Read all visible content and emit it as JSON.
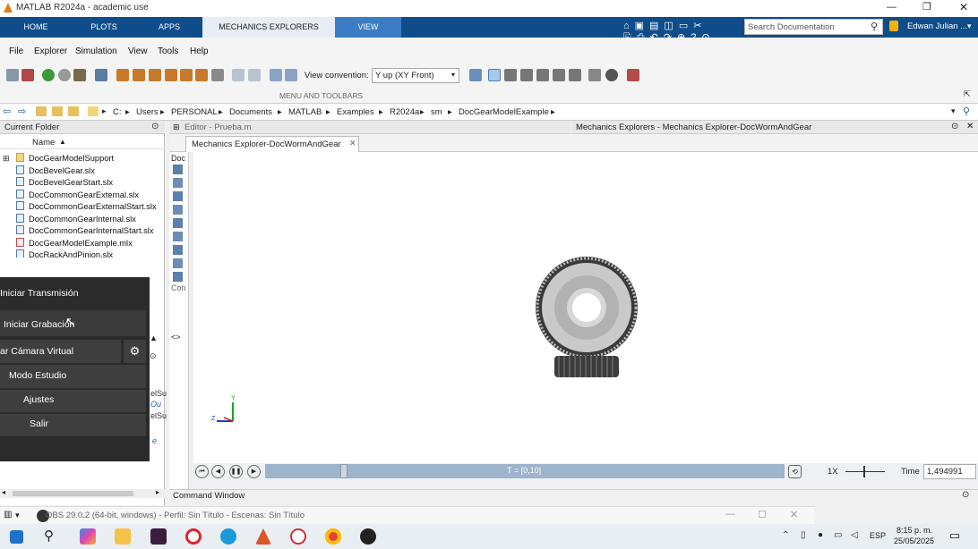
{
  "window": {
    "title": "MATLAB R2024a - academic use"
  },
  "ribbon": {
    "tabs": [
      "HOME",
      "PLOTS",
      "APPS",
      "MECHANICS EXPLORERS",
      "VIEW"
    ],
    "search_placeholder": "Search Documentation",
    "user": "Edwan Julian ...",
    "section_label": "MENU AND TOOLBARS"
  },
  "menu": {
    "items": [
      "File",
      "Explorer",
      "Simulation",
      "View",
      "Tools",
      "Help"
    ],
    "view_convention_label": "View convention:",
    "view_convention_value": "Y up (XY Front)"
  },
  "path": {
    "crumbs": [
      "C:",
      "Users",
      "PERSONAL",
      "Documents",
      "MATLAB",
      "Examples",
      "R2024a",
      "sm",
      "DocGearModelExample"
    ]
  },
  "current_folder": {
    "title": "Current Folder",
    "column": "Name",
    "items": [
      "DocGearModelSupport",
      "DocBevelGear.slx",
      "DocBevelGearStart.slx",
      "DocCommonGearExternal.slx",
      "DocCommonGearExternalStart.slx",
      "DocCommonGearInternal.slx",
      "DocCommonGearInternalStart.slx",
      "DocGearModelExample.mlx",
      "DocRackAndPinion.slx"
    ]
  },
  "editor": {
    "title": "Editor - Prueba.m",
    "mid_label1": "Doc",
    "mid_label2": "Con"
  },
  "mech": {
    "window_title": "Mechanics Explorers - Mechanics Explorer-DocWormAndGear",
    "tab": "Mechanics Explorer-DocWormAndGear",
    "time_range": "T = [0,10]",
    "speed": "1X",
    "time_label": "Time",
    "time_value": "1,494991",
    "axis_y": "Y",
    "axis_z": "Z"
  },
  "obs": {
    "items": [
      "Iniciar Transmisión",
      "Iniciar Grabación",
      "ar Cámara Virtual",
      "Modo Estudio",
      "Ajustes",
      "Salir"
    ]
  },
  "left_snips": [
    "elSu",
    "Ou",
    "elSu",
    "e"
  ],
  "command_window": {
    "label": "Command Window"
  },
  "obs_bar": {
    "title": "OBS 29.0.2 (64-bit, windows) - Perfil: Sin Título - Escenas: Sin Título"
  },
  "taskbar": {
    "language": "ESP",
    "time": "8:15 p. m.",
    "date": "25/05/2025"
  },
  "colors": {
    "ribbon_blue": "#0f4d8a",
    "active_tab": "#e6edf5",
    "obs_panel": "#2b2b2b"
  }
}
